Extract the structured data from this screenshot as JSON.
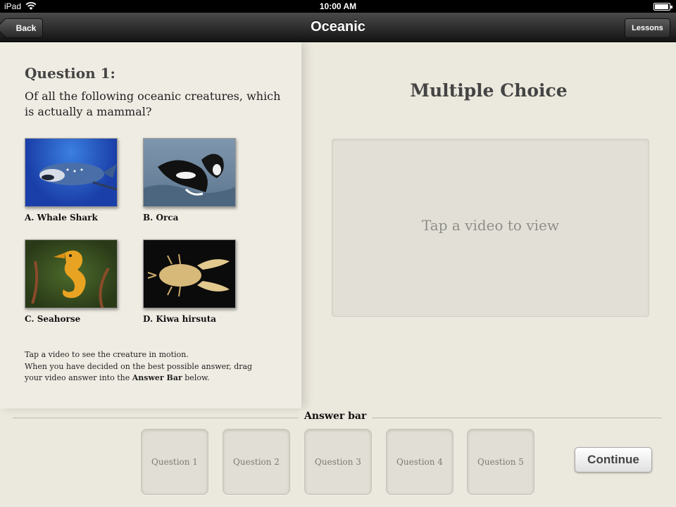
{
  "status_bar": {
    "carrier": "iPad",
    "time": "10:00 AM",
    "wifi_icon": "wifi-icon",
    "battery_icon": "battery-icon",
    "battery_level": 0.85
  },
  "nav": {
    "title": "Oceanic",
    "back_label": "Back",
    "lessons_label": "Lessons"
  },
  "question": {
    "heading": "Question 1:",
    "text": "Of all the following oceanic creatures, which is actually a mammal?",
    "choices": [
      {
        "label": "A. Whale Shark",
        "image": "whale-shark-photo"
      },
      {
        "label": "B. Orca",
        "image": "orca-photo"
      },
      {
        "label": "C. Seahorse",
        "image": "seahorse-photo"
      },
      {
        "label": "D. Kiwa hirsuta",
        "image": "kiwa-hirsuta-photo"
      }
    ],
    "instructions": {
      "line1": "Tap a video to see the creature in motion.",
      "line2": "When you have decided on the best possible answer, drag",
      "line3_prefix": "your video answer into the",
      "line3_bold": "Answer Bar",
      "line3_suffix": "below."
    }
  },
  "video": {
    "title": "Multiple Choice",
    "placeholder": "Tap a video to view"
  },
  "answer_bar": {
    "label": "Answer bar",
    "slots": [
      "Question 1",
      "Question 2",
      "Question 3",
      "Question 4",
      "Question 5"
    ],
    "continue_label": "Continue"
  }
}
